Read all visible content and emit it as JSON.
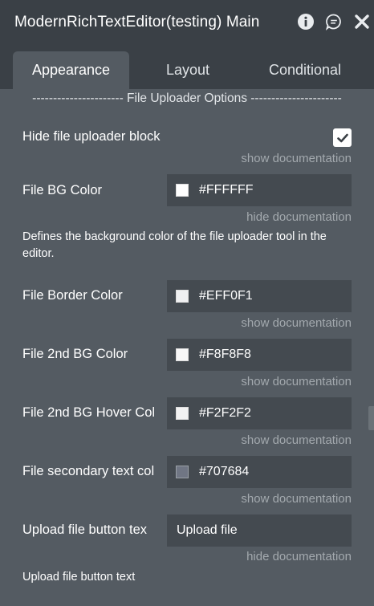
{
  "window": {
    "title": "ModernRichTextEditor(testing) Main"
  },
  "tabs": [
    {
      "label": "Appearance",
      "active": true
    },
    {
      "label": "Layout",
      "active": false
    },
    {
      "label": "Conditional",
      "active": false
    }
  ],
  "section_title": "---------------------- File Uploader Options ----------------------",
  "properties": {
    "hide_uploader": {
      "label": "Hide file uploader block",
      "checked": true,
      "doc_link": "show documentation"
    },
    "file_bg_color": {
      "label": "File BG Color",
      "value": "#FFFFFF",
      "swatch": "#FFFFFF",
      "doc_link": "hide documentation",
      "description": "Defines the background color of the file uploader tool in the editor."
    },
    "file_border_color": {
      "label": "File Border Color",
      "value": "#EFF0F1",
      "swatch": "#EFF0F1",
      "doc_link": "show documentation"
    },
    "file_2nd_bg_color": {
      "label": "File 2nd BG Color",
      "value": "#F8F8F8",
      "swatch": "#F8F8F8",
      "doc_link": "show documentation"
    },
    "file_2nd_bg_hover": {
      "label": "File 2nd BG Hover Col",
      "value": "#F2F2F2",
      "swatch": "#F2F2F2",
      "doc_link": "show documentation"
    },
    "file_secondary_text": {
      "label": "File secondary text col",
      "value": "#707684",
      "swatch": "#707684",
      "doc_link": "show documentation"
    },
    "upload_button_text": {
      "label": "Upload file button tex",
      "value": "Upload file",
      "doc_link": "hide documentation",
      "description": "Upload file button text"
    }
  },
  "colors": {
    "panel_bg": "#545b62",
    "header_bg": "#3a4046",
    "field_bg": "#444a50",
    "doc_link": "#a3a9ae"
  },
  "icons": [
    "info-icon",
    "chat-icon",
    "close-icon",
    "checkmark-icon"
  ]
}
